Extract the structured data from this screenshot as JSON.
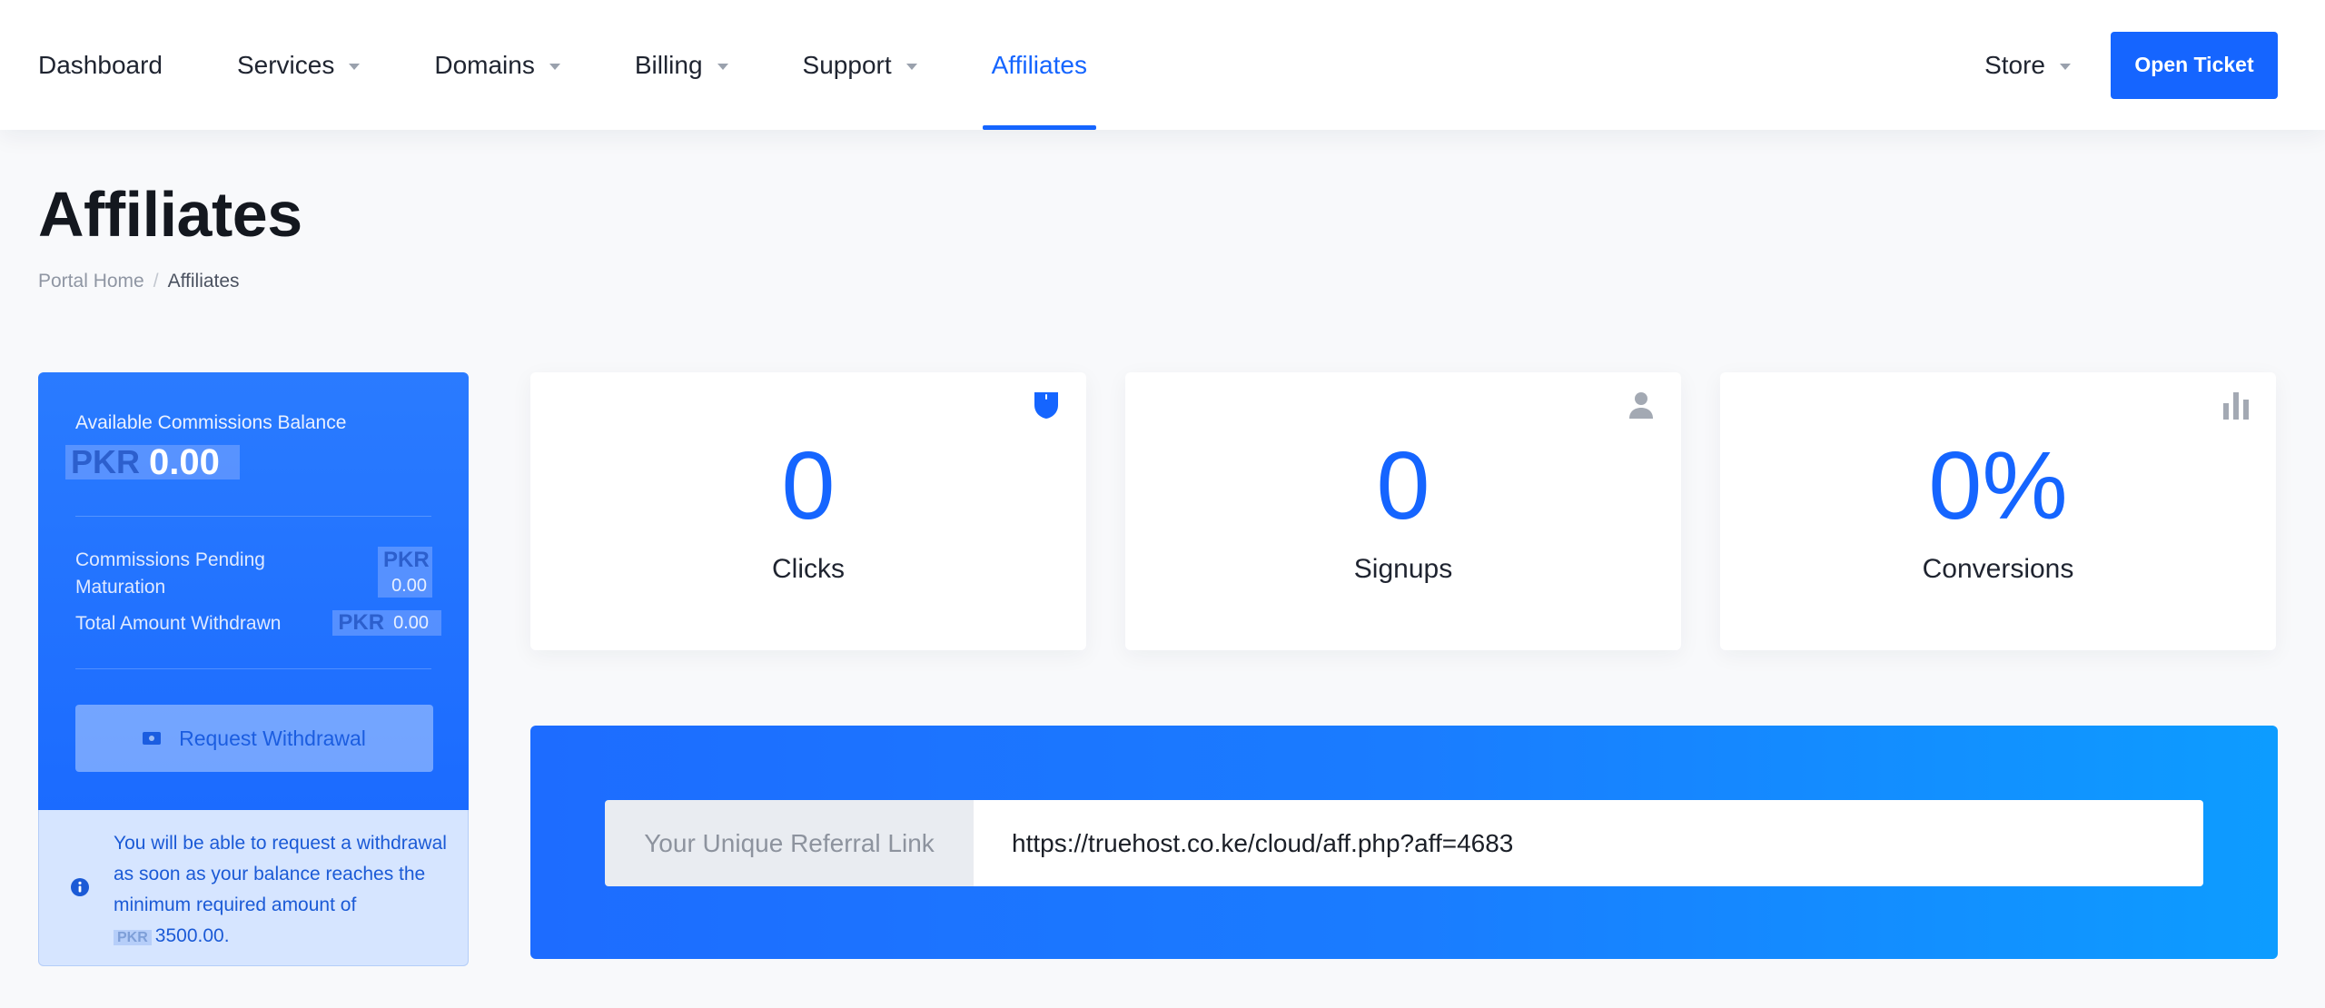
{
  "nav": {
    "items": [
      {
        "label": "Dashboard",
        "dropdown": false,
        "active": false
      },
      {
        "label": "Services",
        "dropdown": true,
        "active": false
      },
      {
        "label": "Domains",
        "dropdown": true,
        "active": false
      },
      {
        "label": "Billing",
        "dropdown": true,
        "active": false
      },
      {
        "label": "Support",
        "dropdown": true,
        "active": false
      },
      {
        "label": "Affiliates",
        "dropdown": false,
        "active": true
      }
    ],
    "store_label": "Store",
    "open_ticket_label": "Open Ticket"
  },
  "page": {
    "title": "Affiliates",
    "breadcrumb": {
      "home": "Portal Home",
      "separator": "/",
      "current": "Affiliates"
    }
  },
  "balance": {
    "available_label": "Available Commissions Balance",
    "currency": "PKR",
    "available_amount": "0.00",
    "pending_label": "Commissions Pending Maturation",
    "pending_amount": "0.00",
    "withdrawn_label": "Total Amount Withdrawn",
    "withdrawn_amount": "0.00",
    "withdraw_button": "Request Withdrawal"
  },
  "info": {
    "text_before": "You will be able to request a withdrawal as soon as your balance reaches the minimum required amount of",
    "currency": "PKR",
    "min_amount": "3500.00."
  },
  "stats": {
    "clicks": {
      "value": "0",
      "label": "Clicks",
      "icon": "cursor-icon"
    },
    "signups": {
      "value": "0",
      "label": "Signups",
      "icon": "user-icon"
    },
    "conversions": {
      "value": "0%",
      "label": "Conversions",
      "icon": "bar-chart-icon"
    }
  },
  "referral": {
    "label": "Your Unique Referral Link",
    "link": "https://truehost.co.ke/cloud/aff.php?aff=4683"
  },
  "colors": {
    "primary": "#1565ff",
    "gradient_start": "#1d6cff",
    "gradient_end": "#0d9cff",
    "info_bg": "#d6e5ff"
  }
}
